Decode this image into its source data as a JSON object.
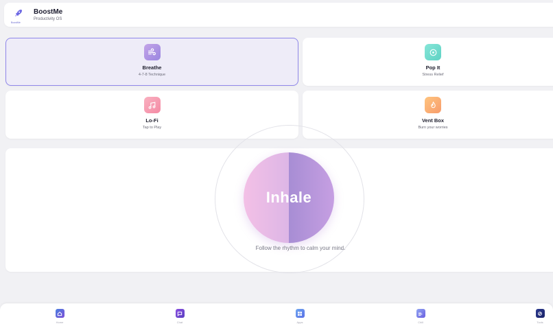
{
  "header": {
    "app_name": "BoostMe",
    "subtitle": "Productivity OS",
    "logo_icon": "rocket-icon",
    "logo_wordmark": "BoostMe"
  },
  "tools": [
    {
      "title": "Breathe",
      "subtitle": "4-7-8 Technique",
      "icon": "breath-lines-icon",
      "color_from": "#b99de4",
      "color_to": "#9a86e0",
      "active": true
    },
    {
      "title": "Pop It",
      "subtitle": "Stress Relief",
      "icon": "circle-target-icon",
      "color_from": "#7fe3d3",
      "color_to": "#5fd2c4",
      "active": false
    },
    {
      "title": "Lo-Fi",
      "subtitle": "Tap to Play",
      "icon": "music-note-icon",
      "color_from": "#f7a3b5",
      "color_to": "#f48aa4",
      "active": false
    },
    {
      "title": "Vent Box",
      "subtitle": "Burn your worries",
      "icon": "flame-icon",
      "color_from": "#ffc07a",
      "color_to": "#f79c6c",
      "active": false
    }
  ],
  "breathing": {
    "phase": "Inhale",
    "hint": "Follow the rhythm to calm your mind."
  },
  "nav": {
    "items": [
      {
        "label": "Home",
        "icon": "home-icon",
        "color": "#4a7fe0"
      },
      {
        "label": "Chat",
        "icon": "chat-bubble-icon",
        "color": "#8a4fe0"
      },
      {
        "label": "Apps",
        "icon": "apps-icon",
        "color": "#5a6fe6"
      },
      {
        "label": "Chill",
        "icon": "chill-icon",
        "color": "#6b5fe0"
      },
      {
        "label": "Tools",
        "icon": "tools-icon",
        "color": "#2b3a8f"
      }
    ]
  },
  "colors": {
    "accent": "#8f87ea",
    "background": "#f1f1f4"
  }
}
